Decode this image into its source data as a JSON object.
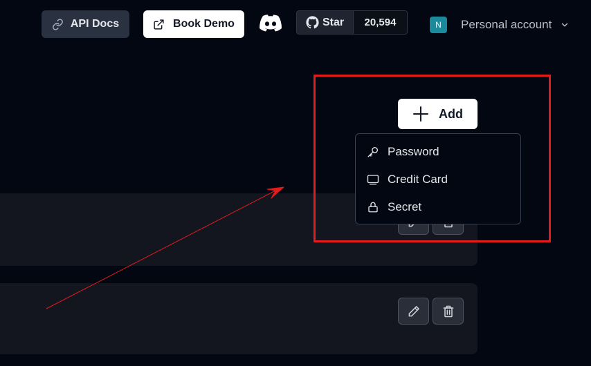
{
  "header": {
    "api_docs_label": "API Docs",
    "book_demo_label": "Book Demo",
    "github": {
      "star_label": "Star",
      "star_count": "20,594"
    },
    "account": {
      "avatar_initial": "N",
      "name": "Personal account"
    }
  },
  "actions": {
    "add_label": "Add",
    "menu_items": [
      {
        "label": "Password",
        "icon": "key-icon"
      },
      {
        "label": "Credit Card",
        "icon": "credit-card-icon"
      },
      {
        "label": "Secret",
        "icon": "lock-icon"
      }
    ]
  },
  "colors": {
    "background": "#030712",
    "card": "#14161f",
    "annotation_red": "#e31b1b",
    "avatar": "#1b8a9c"
  }
}
